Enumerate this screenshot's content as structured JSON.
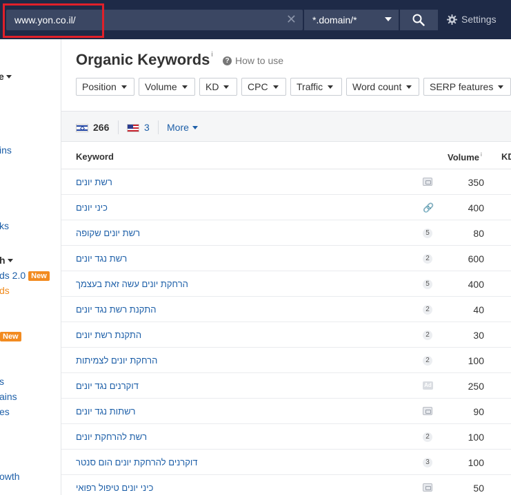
{
  "header": {
    "url": "www.yon.co.il/",
    "clear_glyph": "✕",
    "mode": "*.domain/*",
    "settings_label": "Settings"
  },
  "sidebar": {
    "items": [
      {
        "text": "e",
        "style": "dark",
        "caret": true,
        "top": 0
      },
      {
        "text": "ins",
        "style": "link"
      },
      {
        "text": "ks",
        "style": "link"
      },
      {
        "text": "h",
        "style": "dark",
        "caret": true
      },
      {
        "text": "ds 2.0",
        "style": "link",
        "badge": "New"
      },
      {
        "text": "ds",
        "style": "orange"
      },
      {
        "text": "",
        "style": "link",
        "badge": "New"
      },
      {
        "text": "s",
        "style": "link"
      },
      {
        "text": "ains",
        "style": "link"
      },
      {
        "text": "es",
        "style": "link"
      },
      {
        "text": "owth",
        "style": "link"
      }
    ]
  },
  "main": {
    "title": "Organic Keywords",
    "title_info": "i",
    "how_to_use": "How to use",
    "filters": [
      "Position",
      "Volume",
      "KD",
      "CPC",
      "Traffic",
      "Word count",
      "SERP features"
    ],
    "countries": {
      "il_count": "266",
      "us_count": "3",
      "more_label": "More"
    },
    "table": {
      "col_keyword": "Keyword",
      "col_volume": "Volume",
      "col_volume_info": "i",
      "col_kd": "KD",
      "rows": [
        {
          "keyword": "רשת יונים",
          "serp": "img",
          "serp_text": "",
          "volume": "350"
        },
        {
          "keyword": "כיני יונים",
          "serp": "link",
          "serp_text": "🔗",
          "volume": "400"
        },
        {
          "keyword": "רשת יונים שקופה",
          "serp": "num",
          "serp_text": "5",
          "volume": "80"
        },
        {
          "keyword": "רשת נגד יונים",
          "serp": "num",
          "serp_text": "2",
          "volume": "600"
        },
        {
          "keyword": "הרחקת יונים עשה זאת בעצמך",
          "serp": "num",
          "serp_text": "5",
          "volume": "400"
        },
        {
          "keyword": "התקנת רשת נגד יונים",
          "serp": "num",
          "serp_text": "2",
          "volume": "40"
        },
        {
          "keyword": "התקנת רשת יונים",
          "serp": "num",
          "serp_text": "2",
          "volume": "30"
        },
        {
          "keyword": "הרחקת יונים לצמיתות",
          "serp": "num",
          "serp_text": "2",
          "volume": "100"
        },
        {
          "keyword": "דוקרנים נגד יונים",
          "serp": "ad",
          "serp_text": "Ad",
          "volume": "250"
        },
        {
          "keyword": "רשתות נגד יונים",
          "serp": "img",
          "serp_text": "",
          "volume": "90"
        },
        {
          "keyword": "רשת להרחקת יונים",
          "serp": "num",
          "serp_text": "2",
          "volume": "100"
        },
        {
          "keyword": "דוקרנים להרחקת יונים הום סנטר",
          "serp": "num",
          "serp_text": "3",
          "volume": "100"
        },
        {
          "keyword": "כיני יונים טיפול רפואי",
          "serp": "img",
          "serp_text": "",
          "volume": "50"
        }
      ]
    }
  }
}
